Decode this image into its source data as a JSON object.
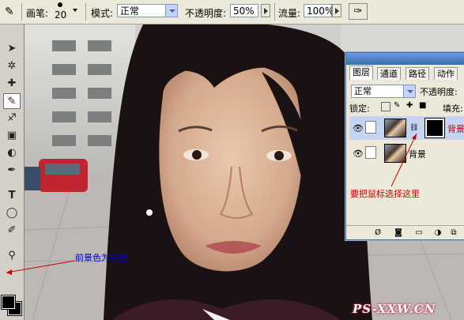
{
  "options_bar": {
    "brush_label": "画笔:",
    "brush_size": "20",
    "mode_label": "模式:",
    "mode_value": "正常",
    "opacity_label": "不透明度:",
    "opacity_value": "50%",
    "flow_label": "流量:",
    "flow_value": "100%"
  },
  "layers_panel": {
    "tabs": [
      "图层",
      "通道",
      "路径",
      "动作"
    ],
    "active_tab": "图层",
    "blend_mode": "正常",
    "opacity_label": "不透明度:",
    "lock_label": "锁定:",
    "fill_label": "填充:",
    "layers": [
      {
        "name": "背景",
        "has_mask": true,
        "active": true,
        "visible": true
      },
      {
        "name": "背景",
        "has_mask": false,
        "active": false,
        "visible": true
      }
    ]
  },
  "annotations": {
    "mask_note": "要把鼠标选择这里",
    "foreground_note": "前景色为白色"
  },
  "watermark": "PS-XXW.CN",
  "colors": {
    "foreground": "#000000",
    "annotation_red": "#cc0000",
    "annotation_blue": "#0000cc",
    "panel_border": "#3a6ea5"
  }
}
